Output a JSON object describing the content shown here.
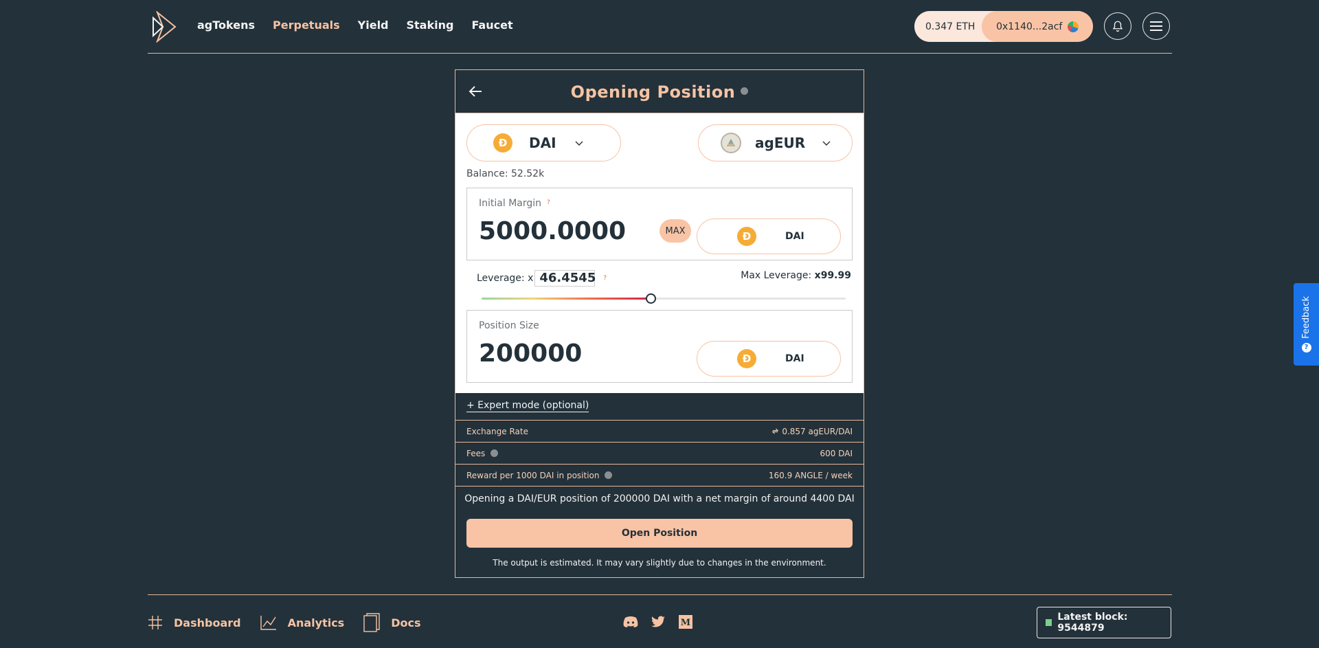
{
  "nav": {
    "items": [
      {
        "label": "agTokens",
        "active": false
      },
      {
        "label": "Perpetuals",
        "active": true
      },
      {
        "label": "Yield",
        "active": false
      },
      {
        "label": "Staking",
        "active": false
      },
      {
        "label": "Faucet",
        "active": false
      }
    ]
  },
  "wallet": {
    "balance": "0.347 ETH",
    "address": "0x1140...2acf"
  },
  "card": {
    "title": "Opening Position",
    "collateral_token": "DAI",
    "target_token": "agEUR",
    "balance": "Balance: 52.52k",
    "initial_margin": {
      "label": "Initial Margin",
      "help": "?",
      "value": "5000.0000",
      "max_label": "MAX",
      "unit": "DAI"
    },
    "leverage": {
      "label": "Leverage: x",
      "value": "46.4545",
      "help": "?",
      "max_label": "Max Leverage: ",
      "max_value": "x99.99"
    },
    "position_size": {
      "label": "Position Size",
      "value": "200000",
      "unit": "DAI"
    },
    "expert_mode": "+ Expert mode (optional)",
    "info_rows": [
      {
        "label": "Exchange Rate",
        "value": "0.857 agEUR/DAI",
        "info": false,
        "swap_icon": true
      },
      {
        "label": "Fees",
        "value": "600 DAI",
        "info": true,
        "swap_icon": false
      },
      {
        "label": "Reward per 1000 DAI in position",
        "value": "160.9 ANGLE / week",
        "info": true,
        "swap_icon": false
      }
    ],
    "summary": "Opening a DAI/EUR position of 200000 DAI with a net margin of around 4400 DAI",
    "open_button": "Open Position",
    "disclaimer": "The output is estimated. It may vary slightly due to changes in the environment."
  },
  "footer": {
    "links": [
      {
        "label": "Dashboard",
        "icon": "grid-icon"
      },
      {
        "label": "Analytics",
        "icon": "chart-icon"
      },
      {
        "label": "Docs",
        "icon": "docs-icon"
      }
    ],
    "social": [
      "discord-icon",
      "twitter-icon",
      "medium-icon"
    ],
    "latest_block": "Latest block: 9544879"
  },
  "feedback": "Feedback",
  "colors": {
    "background": "#23313a",
    "accent": "#f6c3a3",
    "button": "#f9c4a5",
    "dai": "#f5ac37",
    "feedback": "#1a73e8"
  }
}
